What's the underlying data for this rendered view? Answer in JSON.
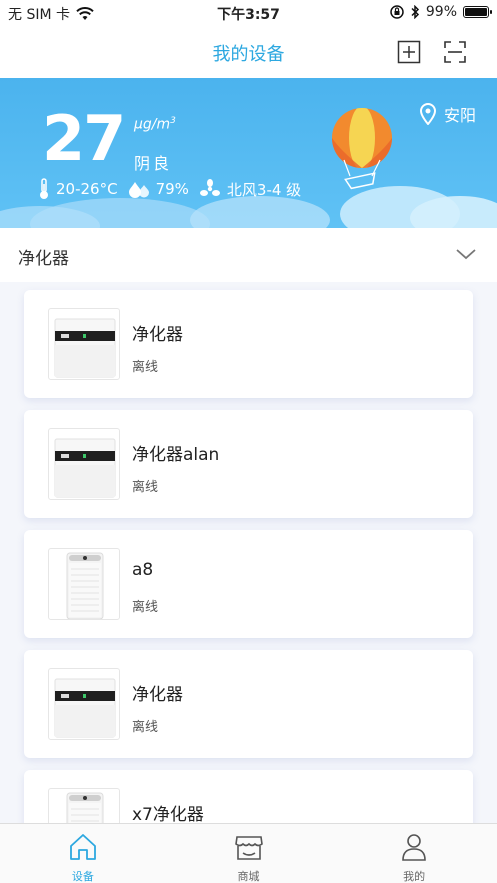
{
  "status_bar": {
    "carrier": "无 SIM 卡",
    "time": "下午3:57",
    "battery": "99%",
    "battery_level": 0.99
  },
  "nav": {
    "title": "我的设备",
    "add_icon": "add-square-icon",
    "scan_icon": "scan-icon"
  },
  "weather": {
    "aqi": "27",
    "unit_base": "μg/m",
    "unit_sup": "3",
    "level": "阴良",
    "location": "安阳",
    "temperature": "20-26°C",
    "humidity": "79%",
    "wind": "北风3-4 级"
  },
  "section": {
    "title": "净化器"
  },
  "devices": [
    {
      "name": "净化器",
      "status": "离线",
      "model": "wide"
    },
    {
      "name": "净化器alan",
      "status": "离线",
      "model": "wide"
    },
    {
      "name": "a8",
      "status": "离线",
      "model": "tall"
    },
    {
      "name": "净化器",
      "status": "离线",
      "model": "wide"
    },
    {
      "name": "x7净化器",
      "status": "",
      "model": "tall"
    }
  ],
  "tabs": [
    {
      "label": "设备",
      "icon": "home-icon",
      "active": true
    },
    {
      "label": "商城",
      "icon": "store-icon",
      "active": false
    },
    {
      "label": "我的",
      "icon": "person-icon",
      "active": false
    }
  ],
  "colors": {
    "accent": "#2da8e0",
    "banner": "#52b9f1"
  }
}
